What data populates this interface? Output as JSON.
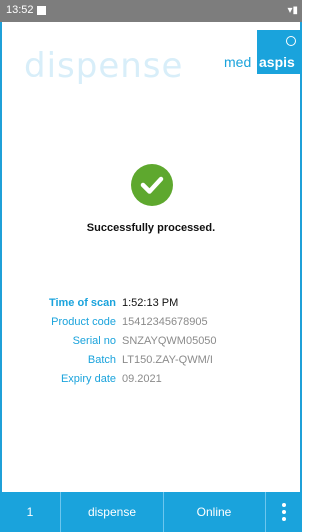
{
  "status_bar": {
    "time": "13:52",
    "signal_icon": "wifi-icon"
  },
  "header": {
    "title": "dispense",
    "logo": {
      "part1": "med",
      "part2": "aspis"
    }
  },
  "result": {
    "message": "Successfully processed.",
    "icon": "check-circle-icon",
    "accent": "#5ea82e"
  },
  "details": [
    {
      "label": "Time of scan",
      "value": "1:52:13 PM"
    },
    {
      "label": "Product code",
      "value": "15412345678905"
    },
    {
      "label": "Serial no",
      "value": "SNZAYQWM05050"
    },
    {
      "label": "Batch",
      "value": "LT150.ZAY-QWM/I"
    },
    {
      "label": "Expiry date",
      "value": "09.2021"
    }
  ],
  "bottom_bar": {
    "count": "1",
    "mode": "dispense",
    "status": "Online",
    "menu_icon": "more-vertical-icon"
  },
  "colors": {
    "brand": "#1aa3dc",
    "status_bar": "#7d7d7d"
  }
}
